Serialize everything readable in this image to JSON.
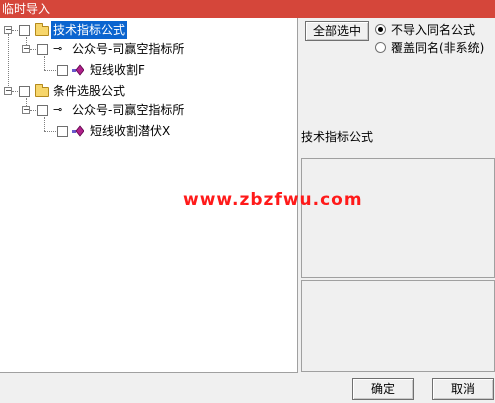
{
  "window": {
    "title": "临时导入"
  },
  "tree": {
    "nodes": [
      {
        "label": "技术指标公式",
        "icon": "folder-icon",
        "selected": true
      },
      {
        "label": "公众号-司赢空指标所",
        "icon": "key-icon"
      },
      {
        "label": "短线收割F",
        "icon": "gem-icon"
      },
      {
        "label": "条件选股公式",
        "icon": "folder-icon"
      },
      {
        "label": "公众号-司赢空指标所",
        "icon": "key-icon"
      },
      {
        "label": "短线收割潜伏X",
        "icon": "gem-icon"
      }
    ]
  },
  "options": {
    "select_all_label": "全部选中",
    "radio_skip_label": "不导入同名公式",
    "radio_overwrite_label": "覆盖同名(非系统)",
    "selected_radio": "skip"
  },
  "info": {
    "section_label": "技术指标公式"
  },
  "watermark": {
    "text": "www.zbzfwu.com"
  },
  "footer": {
    "ok_label": "确定",
    "cancel_label": "取消"
  },
  "colors": {
    "title_bar": "#d5463a",
    "selection": "#0a64cf",
    "watermark": "#ff1a1a"
  }
}
